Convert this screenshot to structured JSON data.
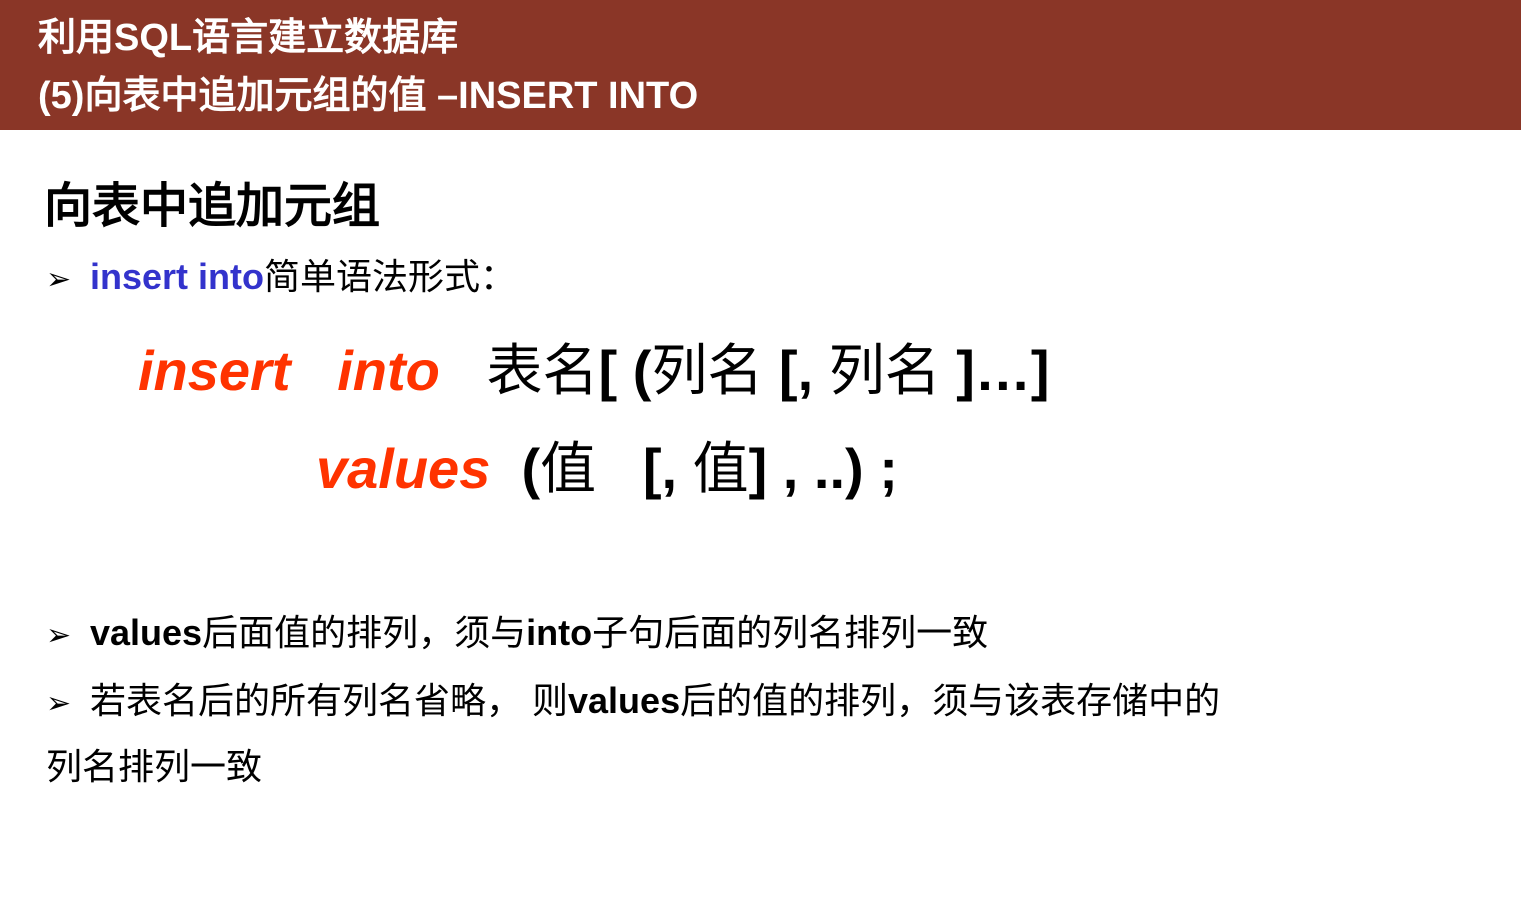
{
  "header": {
    "line1": "利用SQL语言建立数据库",
    "line2": "(5)向表中追加元组的值 –INSERT INTO"
  },
  "section_title": "向表中追加元组",
  "bullet1": {
    "keyword": "insert into",
    "text": "简单语法形式："
  },
  "syntax": {
    "line1": {
      "kw_insert": "insert",
      "kw_into": "into",
      "table": "表名",
      "open": "[ (",
      "col1": "列名",
      "mid": "[,",
      "col2": "列名",
      "close": "]…]"
    },
    "line2": {
      "kw_values": "values",
      "open": "(",
      "val1": "值",
      "mid": "[,",
      "val2": "值",
      "close": "] , ..) ;"
    }
  },
  "bullet2": {
    "kw1": "values",
    "t1": "后面值的排列，须与",
    "kw2": "into",
    "t2": "子句后面的列名排列一致"
  },
  "bullet3": {
    "t1": "若表名后的所有列名省略，  则",
    "kw": "values",
    "t2": "后的值的排列，须与该表存储中的",
    "cont": "列名排列一致"
  }
}
